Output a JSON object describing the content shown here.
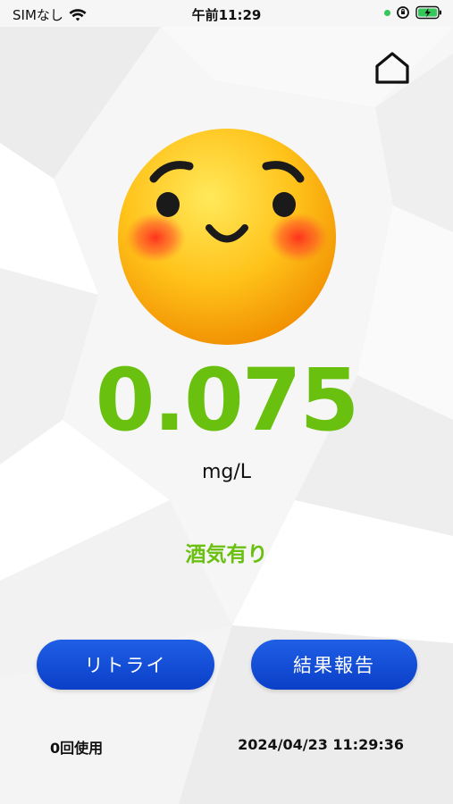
{
  "status_bar": {
    "carrier": "SIMなし",
    "time": "午前11:29",
    "wifi_icon": "wifi-icon",
    "battery_icon": "battery-charging-icon",
    "location_icon": "orientation-lock-icon"
  },
  "header": {
    "home_icon": "home-icon"
  },
  "result": {
    "face_icon": "smiling-blushing-face-icon",
    "value": "0.075",
    "unit": "mg/L",
    "status": "酒気有り",
    "value_color": "#69c00f"
  },
  "actions": {
    "retry_label": "リトライ",
    "report_label": "結果報告",
    "button_color": "#1450d8"
  },
  "footer": {
    "usage": "0回使用",
    "timestamp": "2024/04/23 11:29:36"
  }
}
